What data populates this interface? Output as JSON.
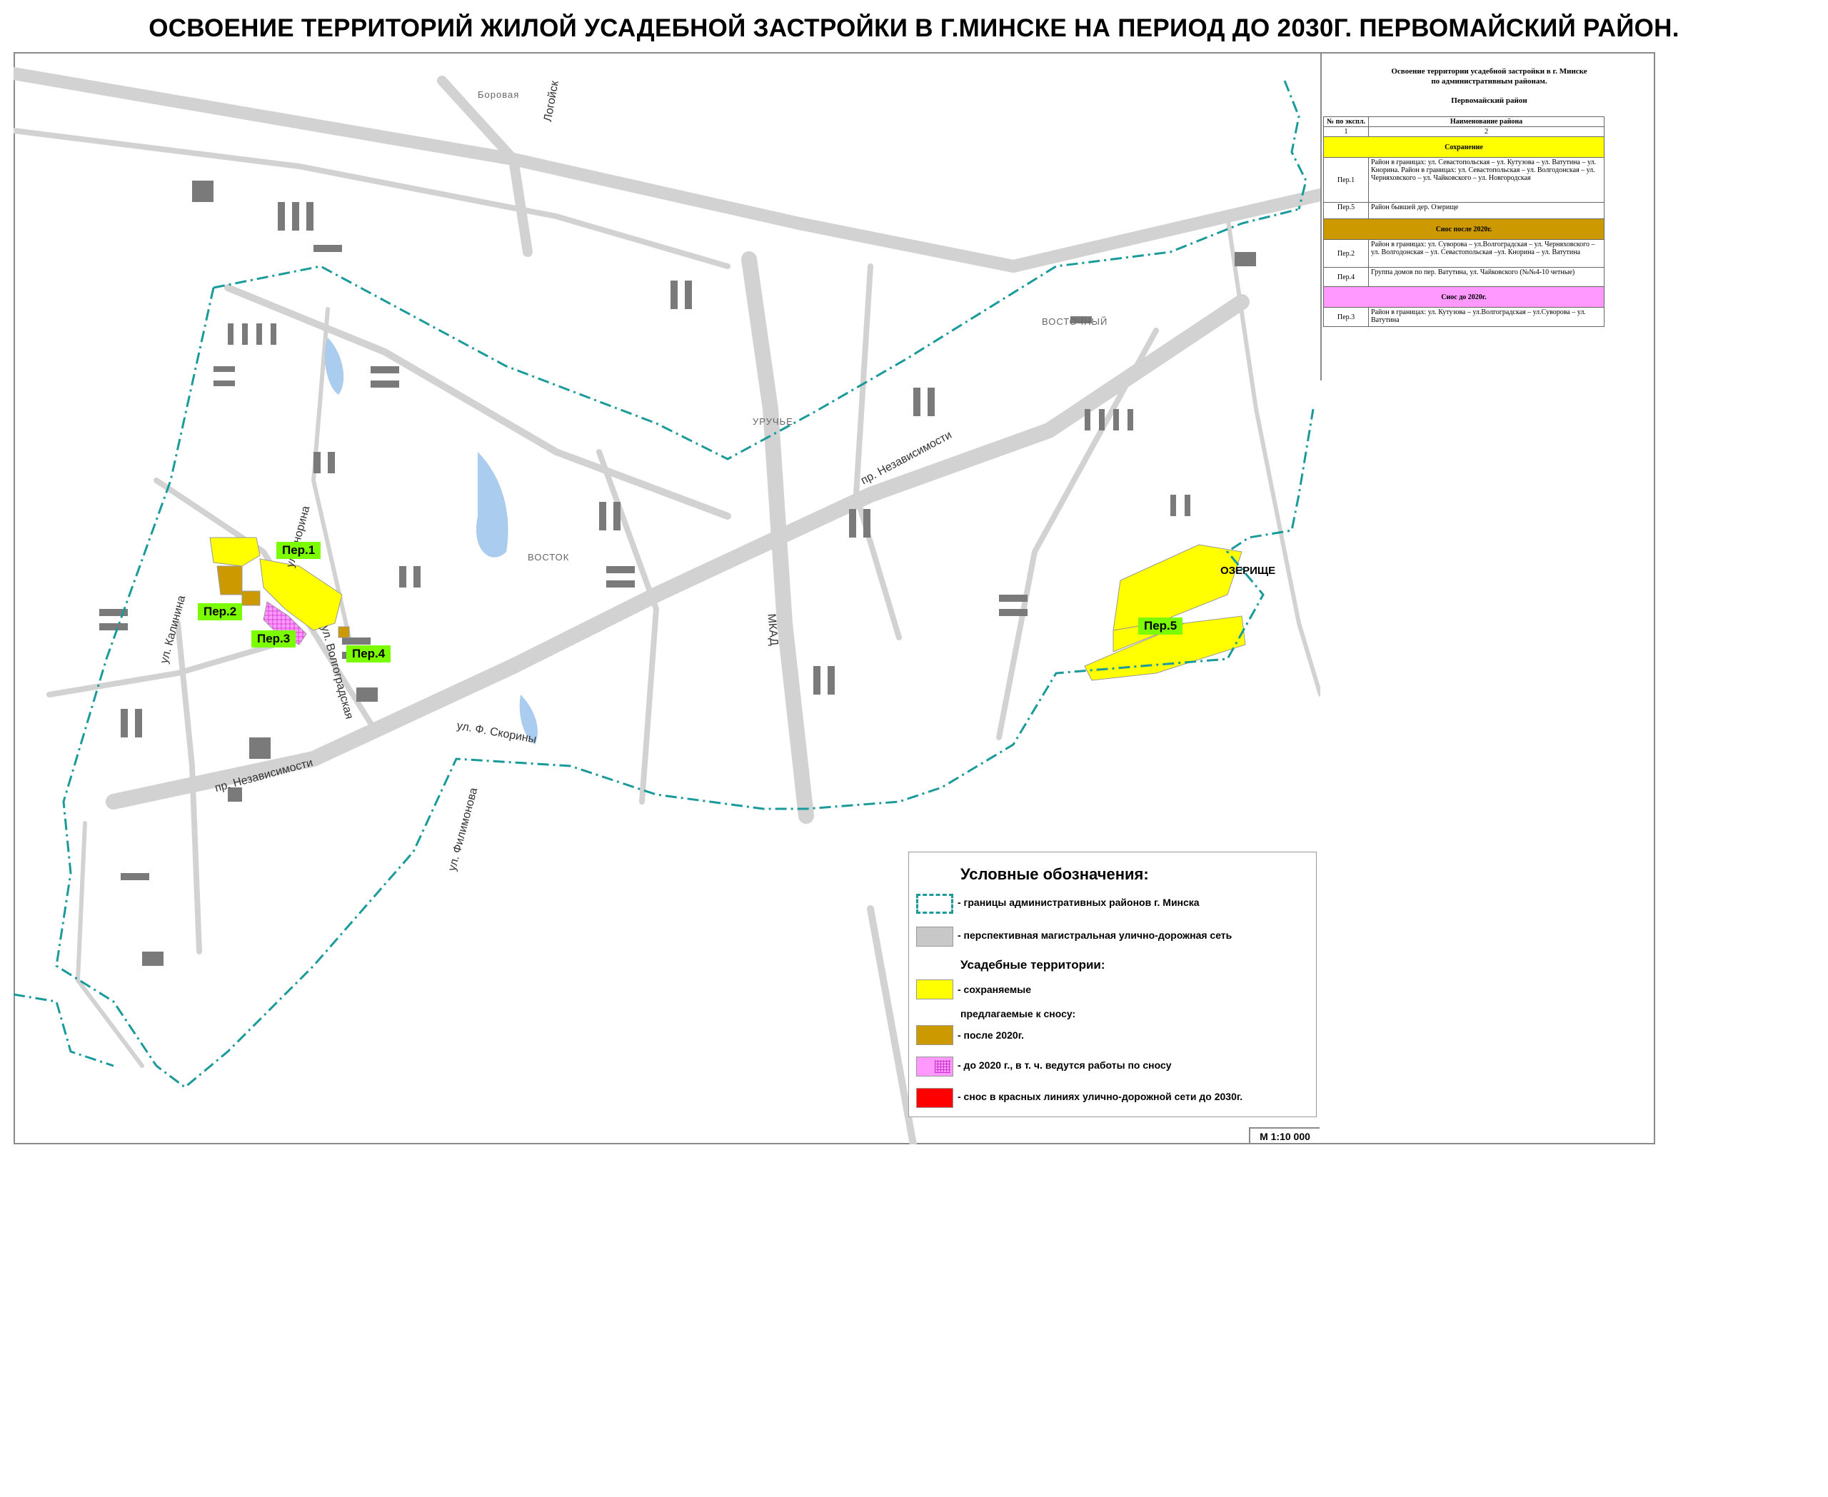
{
  "title": "ОСВОЕНИЕ ТЕРРИТОРИЙ ЖИЛОЙ УСАДЕБНОЙ ЗАСТРОЙКИ В Г.МИНСКЕ НА ПЕРИОД ДО 2030Г. ПЕРВОМАЙСКИЙ РАЙОН.",
  "colors": {
    "boundary": "#1a9a9a",
    "road": "#c8c8c8",
    "preserved": "#ffff00",
    "after_2020": "#cc9900",
    "before_2020": "#ff99ff",
    "red_lines": "#ff0000",
    "tag": "#7cfc00",
    "water": "#aaccee",
    "building": "#7a7a7a"
  },
  "map": {
    "streets": {
      "nezav1": "пр. Независимости",
      "nezav2": "пр. Независимости",
      "mkad": "МКАД",
      "korina": "ул. Кнорина",
      "volgograd": "ул. Волгоградская",
      "skoriny": "ул. Ф. Скорины",
      "filimonova": "ул. Филимонова",
      "kalinina": "ул. Калинина",
      "logoisk": "Логойск"
    },
    "districts": {
      "borovaya": "Боровая",
      "vostochny": "ВОСТОЧНЫЙ",
      "urucce": "УРУЧЬЕ",
      "vostok": "ВОСТОК",
      "ozerishche": "ОЗЕРИЩЕ"
    },
    "tags": {
      "per1": "Пер.1",
      "per2": "Пер.2",
      "per3": "Пер.3",
      "per4": "Пер.4",
      "per5": "Пер.5"
    }
  },
  "info": {
    "heading_line1": "Освоение территории усадебной застройки в г. Минске",
    "heading_line2": "по административным районам.",
    "district": "Первомайский район",
    "col1_header": "№ по экспл.",
    "col2_header": "Наименование района",
    "col1_num": "1",
    "col2_num": "2",
    "sections": {
      "preserve": "Сохранение",
      "after": "Снос после 2020г.",
      "before": "Снос до 2020г."
    },
    "rows": {
      "per1_code": "Пер.1",
      "per1_text": "Район в границах: ул. Севастопольская – ул. Кутузова – ул. Ватутина – ул. Кнорина. Район в границах: ул. Севастопольская – ул. Волгодонская – ул. Черняховского – ул. Чайковского – ул. Новгородская",
      "per5_code": "Пер.5",
      "per5_text": "Район бывшей дер. Озерище",
      "per2_code": "Пер.2",
      "per2_text": "Район в границах: ул. Суворова – ул.Волгоградская – ул. Черняховского – ул. Волгодонская – ул. Севастопольская –ул. Кнорина – ул. Ватутина",
      "per4_code": "Пер.4",
      "per4_text": "Группа домов по пер. Ватутина, ул. Чайковского (№№4-10 четные)",
      "per3_code": "Пер.3",
      "per3_text": "Район в границах: ул. Кутузова – ул.Волгоградская – ул.Суворова – ул. Ватутина"
    }
  },
  "legend": {
    "title": "Условные обозначения:",
    "boundary": "- границы административных районов г. Минска",
    "roads": "- перспективная магистральная улично-дорожная сеть",
    "estates": "Усадебные территории:",
    "preserved": "- сохраняемые",
    "proposed": "предлагаемые к сносу:",
    "after_2020": "- после 2020г.",
    "before_2020": "- до 2020 г., в т. ч.  ведутся работы по сносу",
    "red_lines": "- снос в красных линиях улично-дорожной сети до 2030г."
  },
  "scale": "М 1:10 000"
}
